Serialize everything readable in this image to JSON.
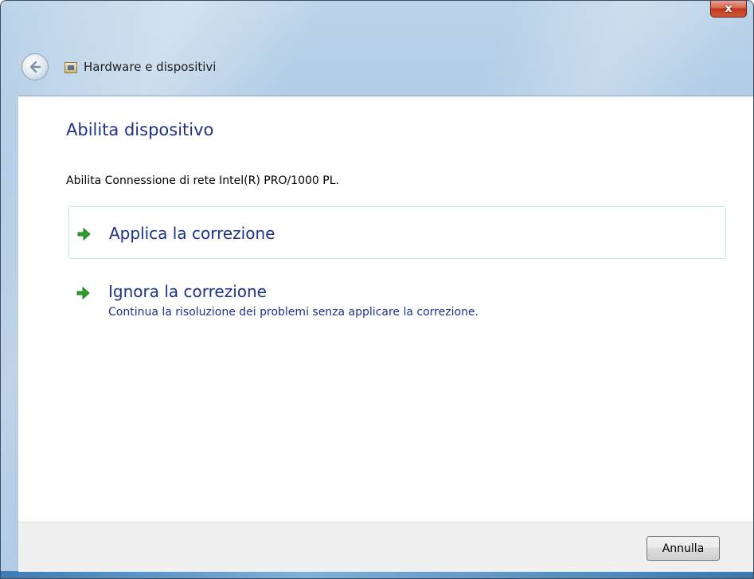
{
  "window": {
    "close_label": "x"
  },
  "nav": {
    "breadcrumb": "Hardware e dispositivi"
  },
  "main": {
    "title": "Abilita dispositivo",
    "description": "Abilita Connessione di rete Intel(R) PRO/1000 PL.",
    "options": [
      {
        "title": "Applica la correzione",
        "subtitle": ""
      },
      {
        "title": "Ignora la correzione",
        "subtitle": "Continua la risoluzione dei problemi senza applicare la correzione."
      }
    ]
  },
  "footer": {
    "cancel_label": "Annulla"
  },
  "colors": {
    "link_blue": "#1e3287",
    "arrow_green": "#2f9e2a",
    "selection_border": "#c4e3f5"
  },
  "icons": {
    "back": "back-arrow-icon",
    "breadcrumb": "control-panel-icon",
    "option": "green-arrow-icon",
    "close": "close-icon"
  }
}
